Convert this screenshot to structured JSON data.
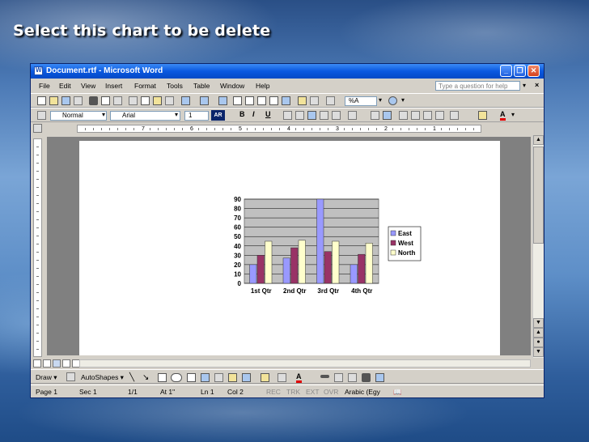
{
  "slide": {
    "title": "Select this chart to be delete"
  },
  "window": {
    "title": "Document.rtf - Microsoft Word",
    "minimize": "_",
    "restore": "❐",
    "close": "✕"
  },
  "menubar": {
    "items": [
      "File",
      "Edit",
      "View",
      "Insert",
      "Format",
      "Tools",
      "Table",
      "Window",
      "Help"
    ],
    "help_placeholder": "Type a question for help",
    "close_doc": "×"
  },
  "formatting": {
    "style": "Normal",
    "font": "Arial",
    "size": "1",
    "ar": "AR",
    "bold": "B",
    "italic": "I",
    "underline": "U"
  },
  "standard": {
    "zoom": "%A"
  },
  "ruler": {
    "numbers": [
      "7",
      "6",
      "5",
      "4",
      "3",
      "2",
      "1"
    ]
  },
  "drawing": {
    "draw": "Draw ▾",
    "autoshapes": "AutoShapes ▾"
  },
  "status": {
    "page": "Page 1",
    "section": "Sec 1",
    "pages": "1/1",
    "at": "At 1\"",
    "line": "Ln 1",
    "col": "Col 2",
    "rec": "REC",
    "trk": "TRK",
    "ext": "EXT",
    "ovr": "OVR",
    "language": "Arabic (Egy"
  },
  "chart_data": {
    "type": "bar",
    "categories": [
      "1st Qtr",
      "2nd Qtr",
      "3rd Qtr",
      "4th Qtr"
    ],
    "series": [
      {
        "name": "East",
        "values": [
          20,
          27,
          90,
          20
        ],
        "color": "#9999ff"
      },
      {
        "name": "West",
        "values": [
          30,
          38,
          34,
          31
        ],
        "color": "#993366"
      },
      {
        "name": "North",
        "values": [
          45,
          46,
          45,
          43
        ],
        "color": "#ffffcc"
      }
    ],
    "yticks": [
      "0",
      "10",
      "20",
      "30",
      "40",
      "50",
      "60",
      "70",
      "80",
      "90"
    ],
    "ylim": [
      0,
      90
    ],
    "grid": true,
    "legend": "right",
    "plot_bg": "#c0c0c0"
  }
}
